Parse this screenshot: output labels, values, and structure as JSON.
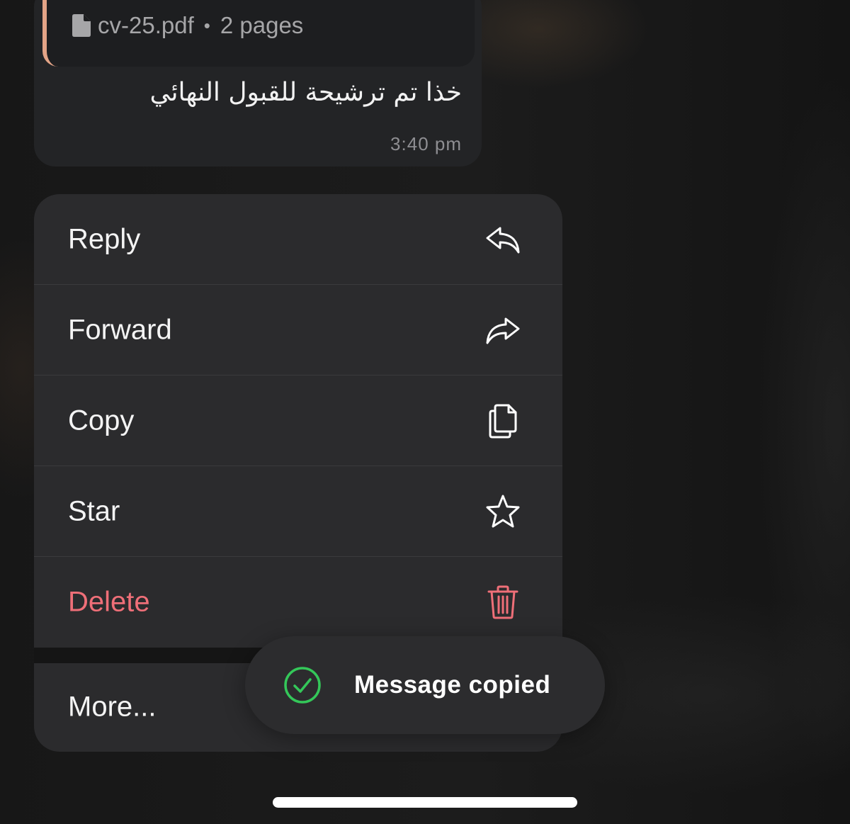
{
  "message": {
    "attachment": {
      "file_name": "cv-25.pdf",
      "separator": "•",
      "pages": "2 pages",
      "icon": "document-icon"
    },
    "text": "خذا تم ترشيحة للقبول النهائي",
    "time": "3:40 pm"
  },
  "menu": {
    "items": [
      {
        "label": "Reply",
        "icon": "reply-icon"
      },
      {
        "label": "Forward",
        "icon": "forward-icon"
      },
      {
        "label": "Copy",
        "icon": "copy-icon"
      },
      {
        "label": "Star",
        "icon": "star-icon"
      },
      {
        "label": "Delete",
        "icon": "trash-icon"
      }
    ],
    "more_label": "More..."
  },
  "toast": {
    "text": "Message copied",
    "icon": "check-circle-icon"
  },
  "colors": {
    "accent_attachment_bar": "#e3a487",
    "danger": "#ef6f78",
    "success": "#34c759"
  }
}
